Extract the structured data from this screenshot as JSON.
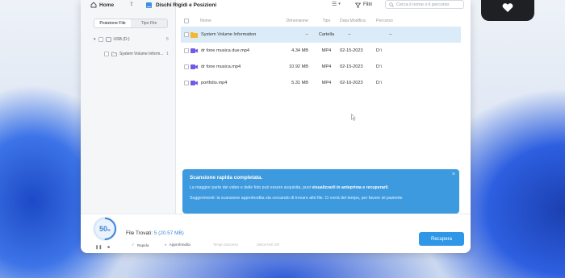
{
  "toolbar": {
    "home_label": "Home",
    "breadcrumb": "Dischi Rigidi e Posizioni",
    "filter_label": "Filtri",
    "search_placeholder": "Cerca il nome o il percorso"
  },
  "sidebar": {
    "tabs": [
      "Posizione File",
      "Tipo File"
    ],
    "active_tab": 0,
    "tree": [
      {
        "label": "USB (D:)",
        "count": "5"
      },
      {
        "label": "System Volume Inform...",
        "count": "1"
      }
    ]
  },
  "table": {
    "headers": [
      "Nome",
      "Dimensione",
      "Tipo",
      "Data Modifica",
      "Percorso"
    ],
    "rows": [
      {
        "name": "System Volume Information",
        "size": "--",
        "type": "Cartella",
        "date": "--",
        "path": "--",
        "icon": "folder-icon",
        "selected": true
      },
      {
        "name": "dr fone musica due.mp4",
        "size": "4.34 MB",
        "type": "MP4",
        "date": "02-15-2023",
        "path": "D:\\",
        "icon": "video-icon",
        "selected": false
      },
      {
        "name": "dr fone musica.mp4",
        "size": "10.92 MB",
        "type": "MP4",
        "date": "02-15-2023",
        "path": "D:\\",
        "icon": "video-icon",
        "selected": false
      },
      {
        "name": "portfolio.mp4",
        "size": "5.31 MB",
        "type": "MP4",
        "date": "02-16-2023",
        "path": "D:\\",
        "icon": "video-icon",
        "selected": false
      }
    ]
  },
  "notice": {
    "title": "Scansione rapida completata.",
    "line1_pre": "La maggior parte dei video e delle foto può essere acquisita, puoi ",
    "line1_bold": "visualizzarli in anteprima e recuperarli",
    "line1_post": ".",
    "line2": "Suggerimenti: la scansione approfondita sta cercando di trovare altri file. Ci vorrà del tempo, per favore sii paziente"
  },
  "status": {
    "progress_percent": 50,
    "percent_label": "50",
    "percent_sign": "%",
    "found_label": "File Trovati:",
    "found_value": "5 (20.57 MB)",
    "mode_quick": "Rapida",
    "mode_deep": "Approfondita",
    "faint_1": "Tempo trascorso",
    "faint_2": "Settori letti: 0/0",
    "recover_label": "Recupera"
  },
  "colors": {
    "accent": "#2f97e8",
    "notice_bg": "#3d9adf",
    "selected_row": "#dbecf8"
  }
}
